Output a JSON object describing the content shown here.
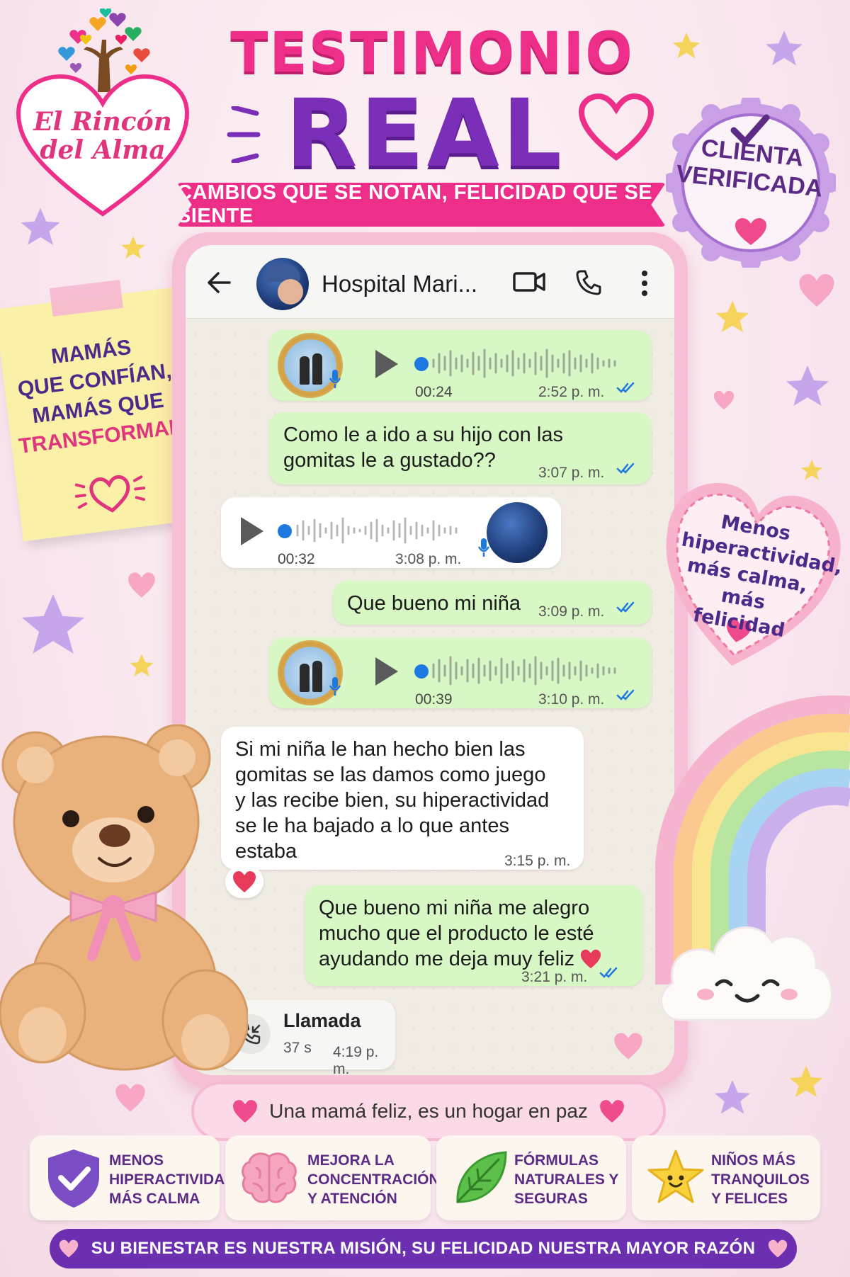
{
  "logo": {
    "line1": "El Rincón",
    "line2": "del Alma"
  },
  "title": {
    "line1": "TESTIMONIO",
    "line2": "REAL"
  },
  "ribbon": "CAMBIOS QUE SE NOTAN, FELICIDAD QUE SE SIENTE",
  "badge": {
    "line1": "CLIENTA",
    "line2": "VERIFICADA"
  },
  "note": {
    "line1": "MAMÁS",
    "line2": "QUE CONFÍAN,",
    "line3": "MAMÁS QUE",
    "line4": "TRANSFORMAN"
  },
  "chat": {
    "contact_name": "Hospital Mari...",
    "messages": [
      {
        "type": "voice",
        "direction": "out",
        "duration": "00:24",
        "time": "2:52 p. m."
      },
      {
        "type": "text",
        "direction": "out",
        "line1": "Como le a ido a su hijo con las",
        "line2": "gomitas le a gustado??",
        "time": "3:07 p. m."
      },
      {
        "type": "voice",
        "direction": "in",
        "duration": "00:32",
        "time": "3:08 p. m."
      },
      {
        "type": "text",
        "direction": "out",
        "text": "Que bueno mi niña",
        "time": "3:09 p. m."
      },
      {
        "type": "voice",
        "direction": "out",
        "duration": "00:39",
        "time": "3:10 p. m."
      },
      {
        "type": "text",
        "direction": "in",
        "line1": "Si mi niña le han hecho bien las",
        "line2": "gomitas se las damos como juego",
        "line3": "y las recibe bien, su hiperactividad",
        "line4": "se le ha bajado a lo que antes",
        "line5": "estaba",
        "time": "3:15 p. m."
      },
      {
        "type": "text",
        "direction": "out",
        "line1": "Que bueno mi niña me alegro",
        "line2": "mucho que el producto le esté",
        "line3": "ayudando me deja muy feliz",
        "time": "3:21 p. m."
      },
      {
        "type": "call",
        "title": "Llamada",
        "duration": "37 s",
        "time": "4:19 p. m."
      }
    ]
  },
  "heart_sticker": {
    "line1": "Menos",
    "line2": "hiperactividad,",
    "line3": "más calma,",
    "line4": "más felicidad"
  },
  "motto": "Una mamá feliz, es un hogar en paz",
  "features": [
    {
      "icon": "shield-check-icon",
      "line1": "MENOS",
      "line2": "HIPERACTIVIDAD",
      "line3": "MÁS CALMA"
    },
    {
      "icon": "brain-icon",
      "line1": "MEJORA LA",
      "line2": "CONCENTRACIÓN",
      "line3": "Y ATENCIÓN"
    },
    {
      "icon": "leaf-icon",
      "line1": "FÓRMULAS",
      "line2": "NATURALES Y",
      "line3": "SEGURAS"
    },
    {
      "icon": "star-face-icon",
      "line1": "NIÑOS MÁS",
      "line2": "TRANQUILOS",
      "line3": "Y FELICES"
    }
  ],
  "footer": "SU BIENESTAR ES NUESTRA MISIÓN, SU FELICIDAD NUESTRA MAYOR RAZÓN",
  "colors": {
    "pink": "#ee2f8a",
    "purple": "#7b2fb8",
    "chat_out": "#d7f7c4",
    "chat_in": "#ffffff",
    "tick_blue": "#1d78e0"
  }
}
